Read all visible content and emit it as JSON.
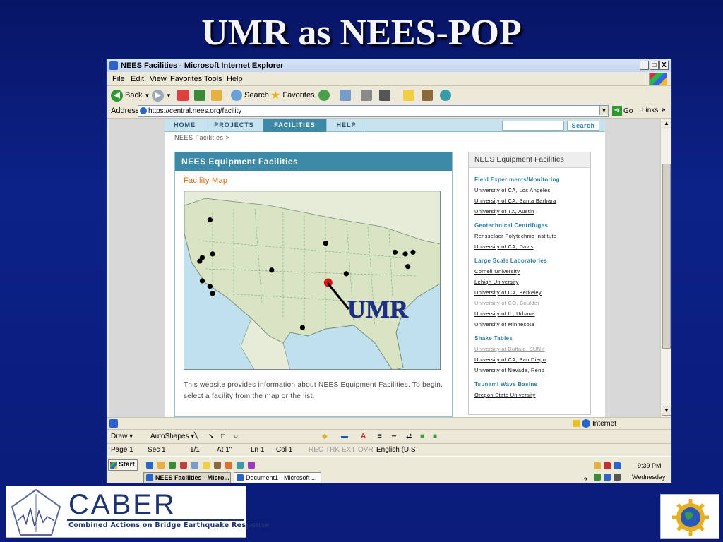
{
  "slide": {
    "title": "UMR as  NEES-POP",
    "annotation_label": "UMR"
  },
  "window": {
    "title": "NEES Facilities - Microsoft Internet Explorer",
    "controls": [
      "_",
      "□",
      "X"
    ]
  },
  "menubar": [
    "File",
    "Edit",
    "View",
    "Favorites",
    "Tools",
    "Help"
  ],
  "toolbar": {
    "back_label": "Back",
    "search_label": "Search",
    "favorites_label": "Favorites"
  },
  "address": {
    "label": "Address",
    "url": "https://central.nees.org/facility",
    "go_label": "Go",
    "links_label": "Links"
  },
  "site": {
    "nav": [
      "HOME",
      "PROJECTS",
      "FACILITIES",
      "HELP"
    ],
    "active_nav": "FACILITIES",
    "search_button": "Search",
    "breadcrumb": "NEES Facilities >",
    "main_title": "NEES Equipment Facilities",
    "map_title": "Facility Map",
    "intro": "This website provides information about NEES Equipment Facilities. To begin, select a facility from the map or the list.",
    "sidebar_title": "NEES Equipment Facilities",
    "categories": [
      {
        "name": "Field Experiments/Monitoring",
        "links": [
          "University of CA, Los Angeles",
          "University of CA, Santa Barbara",
          "University of TX, Austin"
        ]
      },
      {
        "name": "Geotechnical Centrifuges",
        "links": [
          "Rensselaer Polytechnic Institute",
          "University of CA, Davis"
        ]
      },
      {
        "name": "Large Scale Laboratories",
        "links": [
          "Cornell University",
          "Lehigh University",
          "University of CA, Berkeley",
          "University of CO, Boulder",
          "University of IL, Urbana",
          "University of Minnesota"
        ]
      },
      {
        "name": "Shake Tables",
        "links": [
          "University at Buffalo, SUNY",
          "University of CA, San Diego",
          "University of Nevada, Reno"
        ]
      },
      {
        "name": "Tsunami Wave Basins",
        "links": [
          "Oregon State University"
        ]
      }
    ],
    "muted_links": [
      "University of CO, Boulder",
      "University at Buffalo, SUNY"
    ]
  },
  "map": {
    "facility_dot_color": "#000000",
    "umr_dot_color": "#e01010",
    "facility_points": [
      [
        0.1,
        0.16
      ],
      [
        0.07,
        0.37
      ],
      [
        0.06,
        0.39
      ],
      [
        0.11,
        0.35
      ],
      [
        0.07,
        0.5
      ],
      [
        0.1,
        0.53
      ],
      [
        0.11,
        0.57
      ],
      [
        0.34,
        0.44
      ],
      [
        0.55,
        0.29
      ],
      [
        0.63,
        0.46
      ],
      [
        0.86,
        0.35
      ],
      [
        0.82,
        0.34
      ],
      [
        0.89,
        0.34
      ],
      [
        0.87,
        0.42
      ],
      [
        0.46,
        0.76
      ]
    ],
    "umr_point": [
      0.56,
      0.51
    ]
  },
  "ie_status": {
    "zone_label": "Internet"
  },
  "word_drawbar": {
    "draw_label": "Draw ▾",
    "autoshapes_label": "AutoShapes ▾"
  },
  "word_status": {
    "page": "Page 1",
    "section": "Sec 1",
    "pages": "1/1",
    "at": "At  1\"",
    "line": "Ln  1",
    "col": "Col  1",
    "modes": [
      "REC",
      "TRK",
      "EXT",
      "OVR"
    ],
    "language": "English (U.S"
  },
  "taskbar": {
    "start_label": "Start",
    "windows": [
      "NEES Facilities - Micro...",
      "Document1 - Microsoft ..."
    ],
    "active_window": "NEES Facilities - Micro...",
    "time": "9:39 PM",
    "day": "Wednesday"
  },
  "logos": {
    "caber_word": "CABER",
    "caber_subtitle": "Combined Actions on Bridge Earthquake Response"
  }
}
